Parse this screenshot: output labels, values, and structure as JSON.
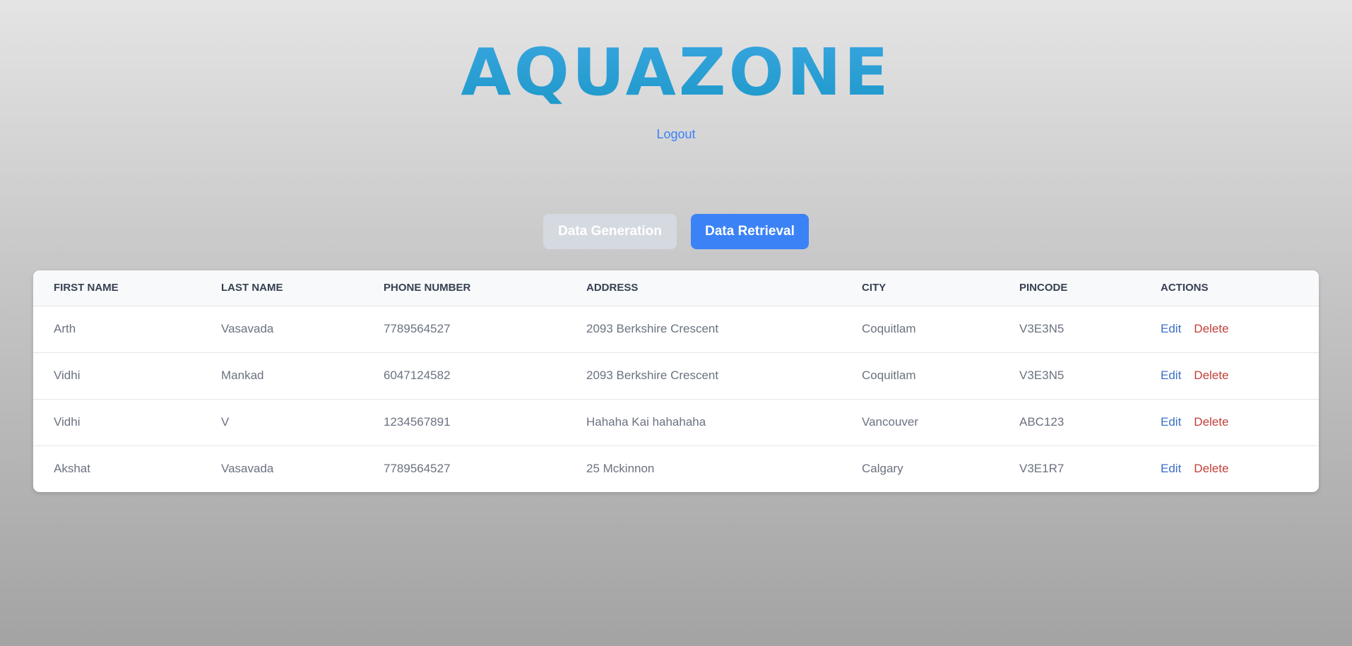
{
  "header": {
    "logo": "AQUAZONE",
    "logout_label": "Logout"
  },
  "tabs": [
    {
      "label": "Data Generation",
      "active": false
    },
    {
      "label": "Data Retrieval",
      "active": true
    }
  ],
  "table": {
    "columns": [
      "FIRST NAME",
      "LAST NAME",
      "PHONE NUMBER",
      "ADDRESS",
      "CITY",
      "PINCODE",
      "ACTIONS"
    ],
    "rows": [
      {
        "first_name": "Arth",
        "last_name": "Vasavada",
        "phone": "7789564527",
        "address": "2093 Berkshire Crescent",
        "city": "Coquitlam",
        "pincode": "V3E3N5",
        "edit": "Edit",
        "delete": "Delete"
      },
      {
        "first_name": "Vidhi",
        "last_name": "Mankad",
        "phone": "6047124582",
        "address": "2093 Berkshire Crescent",
        "city": "Coquitlam",
        "pincode": "V3E3N5",
        "edit": "Edit",
        "delete": "Delete"
      },
      {
        "first_name": "Vidhi",
        "last_name": "V",
        "phone": "1234567891",
        "address": "Hahaha Kai hahahaha",
        "city": "Vancouver",
        "pincode": "ABC123",
        "edit": "Edit",
        "delete": "Delete"
      },
      {
        "first_name": "Akshat",
        "last_name": "Vasavada",
        "phone": "7789564527",
        "address": "25 Mckinnon",
        "city": "Calgary",
        "pincode": "V3E1R7",
        "edit": "Edit",
        "delete": "Delete"
      }
    ]
  },
  "colors": {
    "logo": "#1c98c8",
    "primary": "#3b82f6",
    "inactive_tab": "#d5d9e0",
    "delete": "#c2403a"
  }
}
